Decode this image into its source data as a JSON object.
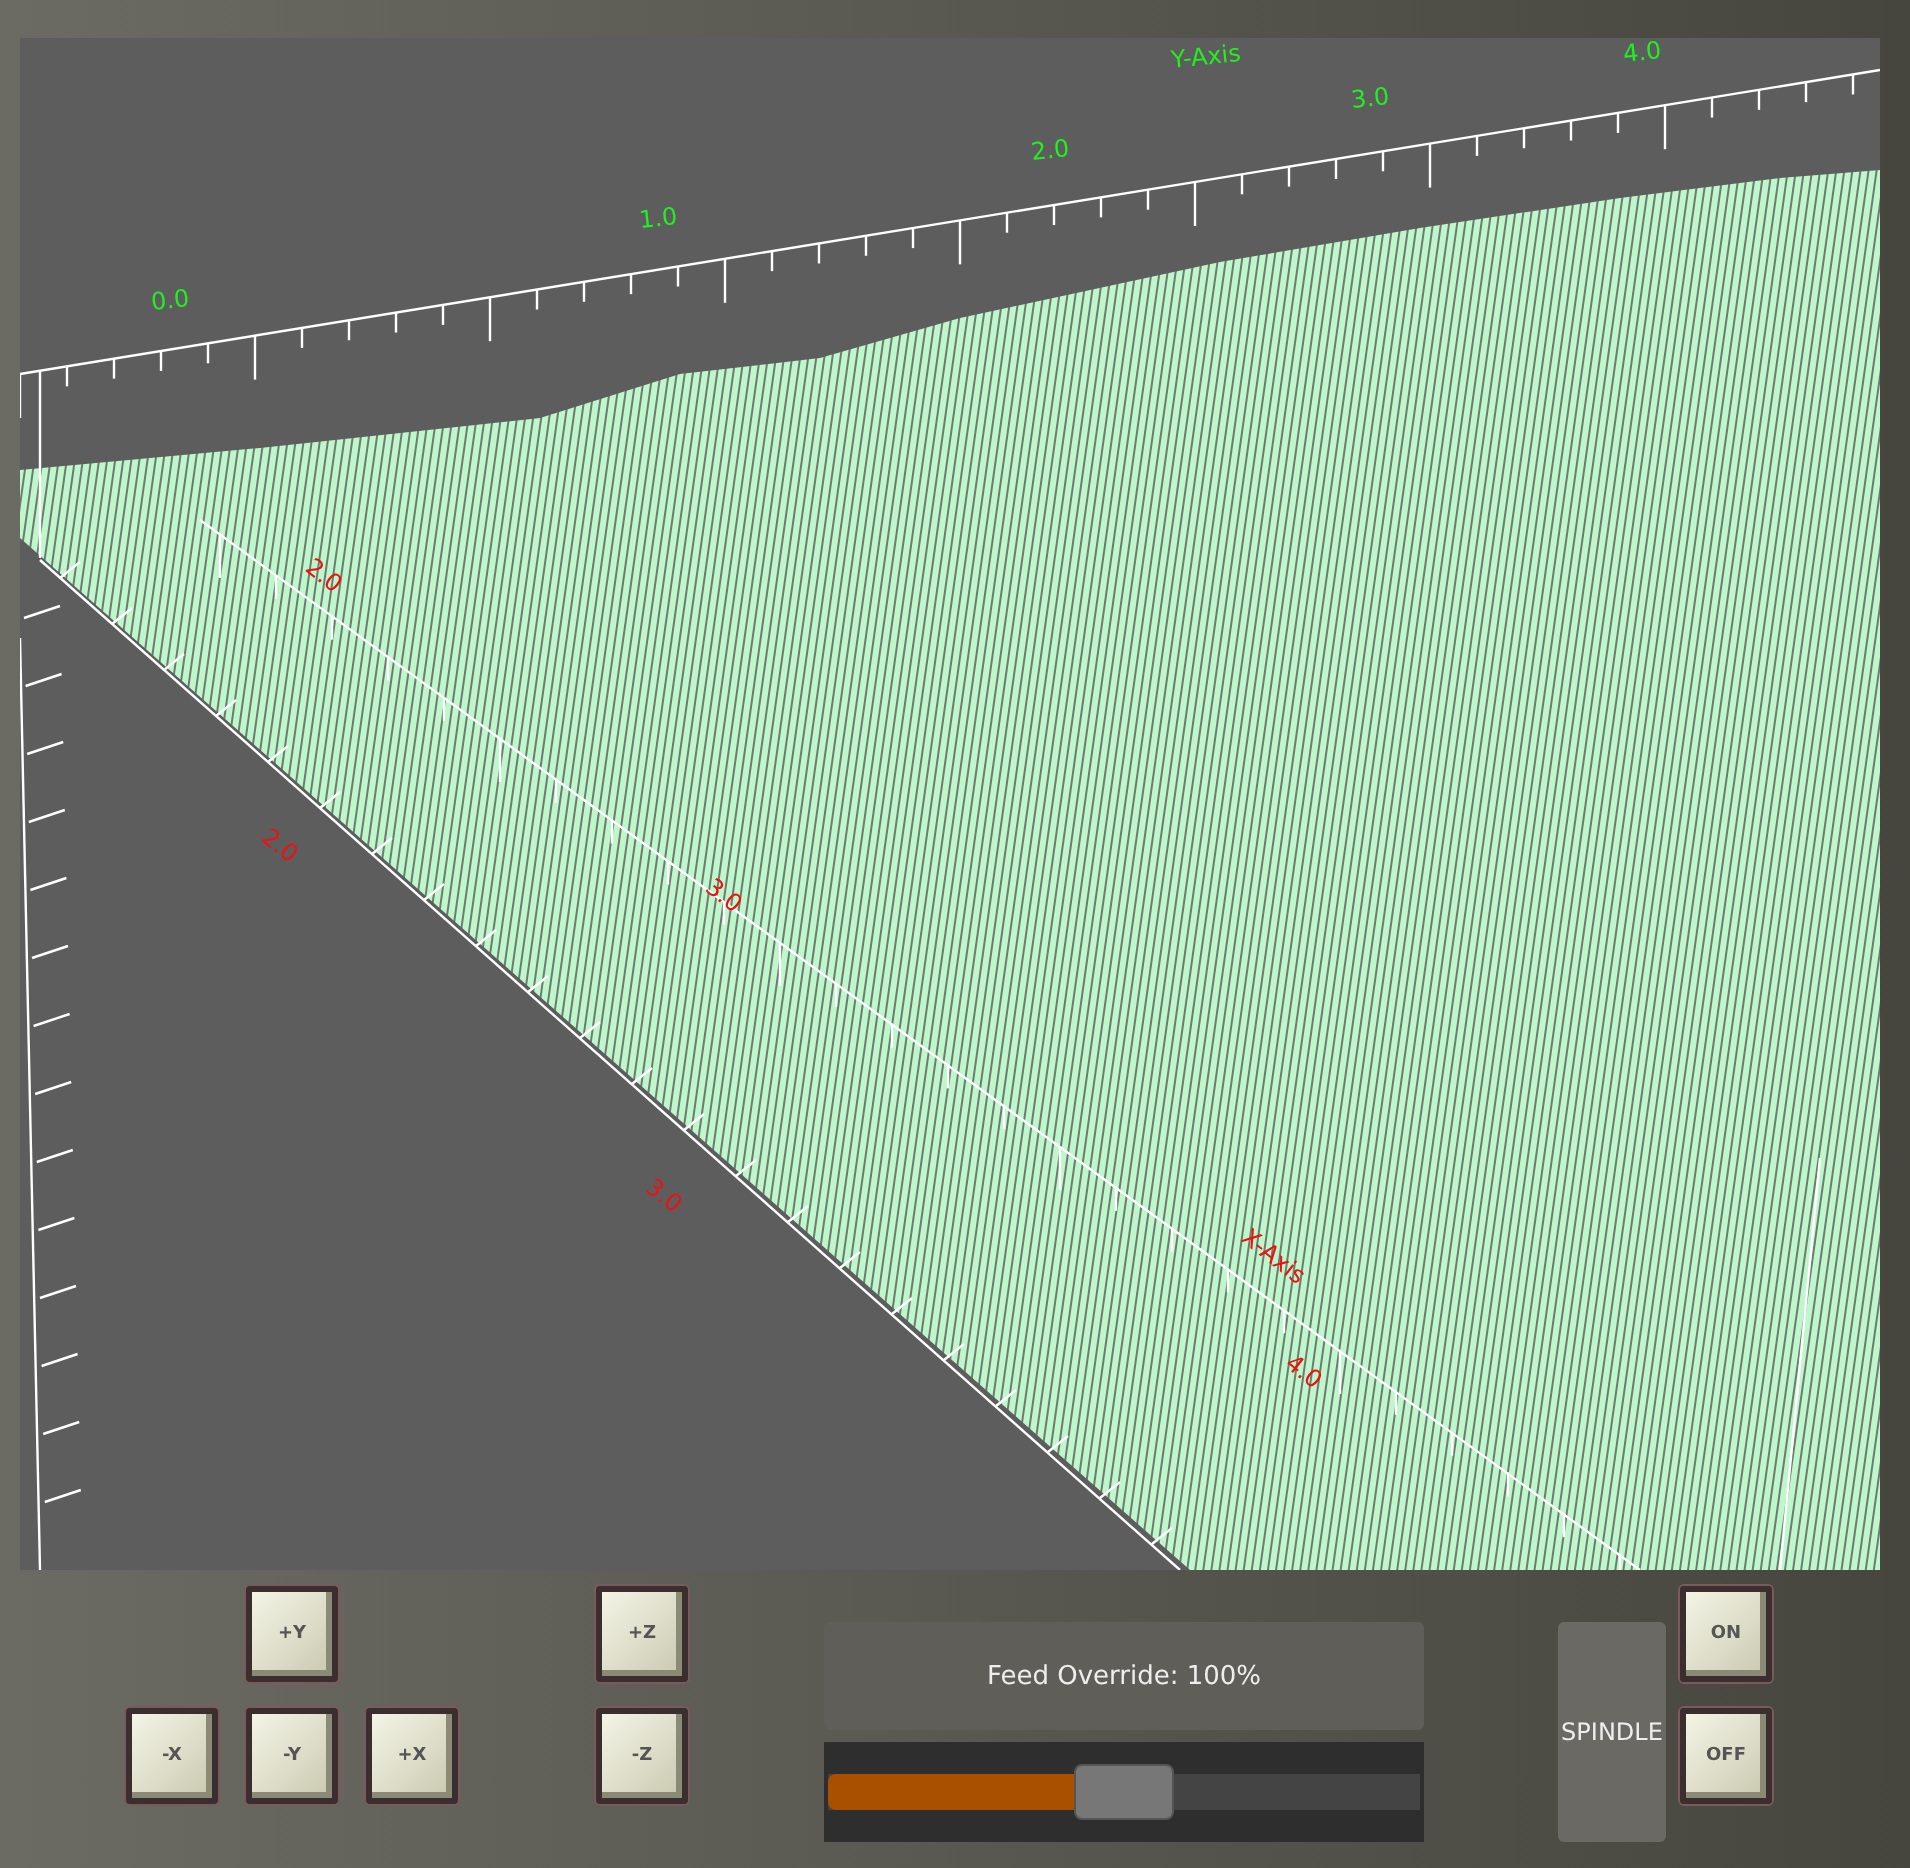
{
  "plot": {
    "y_axis": {
      "title": "Y-Axis",
      "ticks": [
        "0.0",
        "1.0",
        "2.0",
        "3.0",
        "4.0"
      ]
    },
    "x_axis": {
      "title": "X-Axis",
      "labels": [
        "2.0",
        "2.0",
        "3.0",
        "3.0",
        "4.0"
      ]
    }
  },
  "jog_buttons": [
    {
      "label": "+Y"
    },
    {
      "label": "+Z"
    },
    {
      "label": "-X"
    },
    {
      "label": "-Y"
    },
    {
      "label": "+X"
    },
    {
      "label": "-Z"
    }
  ],
  "feed_override": {
    "label": "Feed Override: 100%",
    "level": 0.43
  },
  "spindle": {
    "label": "SPINDLE",
    "buttons": [
      "ON",
      "OFF"
    ]
  }
}
